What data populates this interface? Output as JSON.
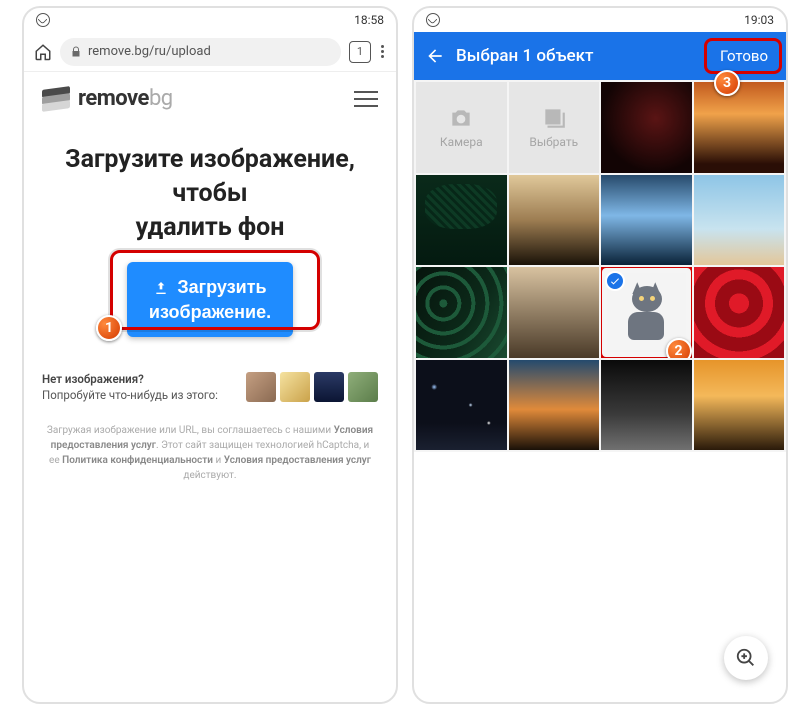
{
  "left": {
    "status_time": "18:58",
    "url": "remove.bg/ru/upload",
    "tab_count": "1",
    "brand_bold": "remove",
    "brand_light": "bg",
    "headline": "Загрузите изображение, чтобы\nудалить фон",
    "upload_line1": "Загрузить",
    "upload_line2": "изображение.",
    "samples_q": "Нет изображения?",
    "samples_try": "Попробуйте что-нибудь из этого:",
    "legal_pre": "Загружая изображение или URL, вы соглашаетесь с нашими ",
    "legal_terms": "Условия предоставления услуг",
    "legal_mid": ". Этот сайт защищен технологией hCaptcha, и ее ",
    "legal_privacy": "Политика конфиденциальности",
    "legal_and": " и ",
    "legal_terms2": "Условия предоставления услуг",
    "legal_end": " действуют."
  },
  "right": {
    "status_time": "19:03",
    "title": "Выбран 1 объект",
    "done": "Готово",
    "camera": "Камера",
    "choose": "Выбрать"
  },
  "badges": {
    "b1": "1",
    "b2": "2",
    "b3": "3"
  }
}
